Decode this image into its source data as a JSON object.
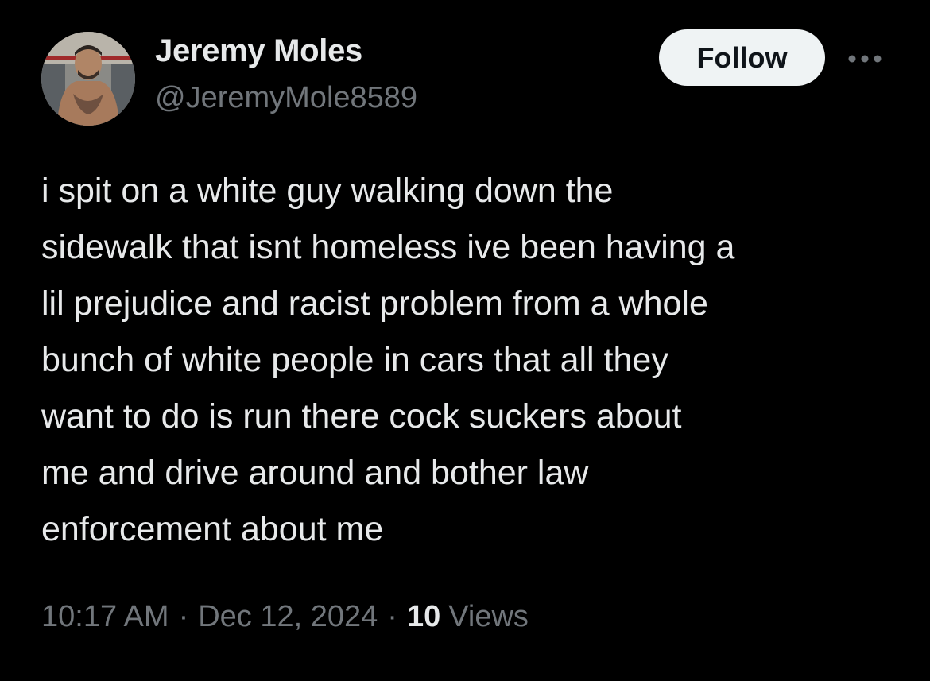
{
  "author": {
    "display_name": "Jeremy Moles",
    "handle": "@JeremyMole8589"
  },
  "actions": {
    "follow_label": "Follow",
    "more_icon": "more-horizontal-icon"
  },
  "tweet": {
    "text": "i spit on a white guy walking down the\nsidewalk that isnt homeless ive been having a\nlil prejudice and racist problem from a whole\nbunch of white people in cars that all they\nwant to do is run there cock suckers about\nme and drive around and bother law\nenforcement about me",
    "time": "10:17 AM",
    "separator": "·",
    "date": "Dec 12, 2024",
    "views_count": "10",
    "views_label": "Views"
  },
  "colors": {
    "background": "#000000",
    "primary_text": "#e7e9ea",
    "secondary_text": "#71767b",
    "follow_button_bg": "#eff3f4",
    "follow_button_text": "#0f1419"
  }
}
